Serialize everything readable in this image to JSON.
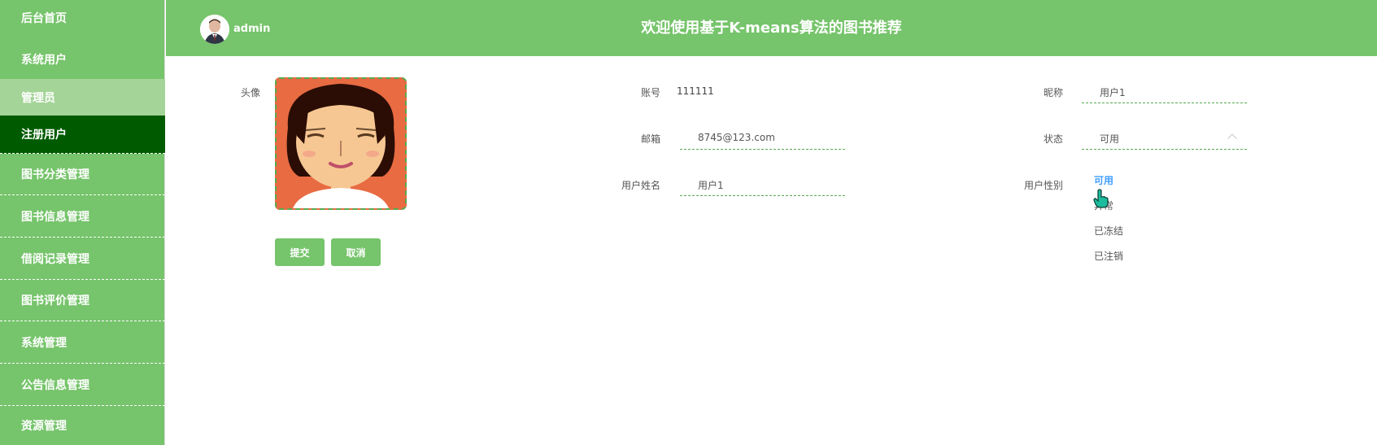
{
  "sidebar": {
    "items": [
      {
        "label": "后台首页"
      },
      {
        "label": "系统用户"
      },
      {
        "label": "管理员"
      },
      {
        "label": "注册用户"
      },
      {
        "label": "图书分类管理"
      },
      {
        "label": "图书信息管理"
      },
      {
        "label": "借阅记录管理"
      },
      {
        "label": "图书评价管理"
      },
      {
        "label": "系统管理"
      },
      {
        "label": "公告信息管理"
      },
      {
        "label": "资源管理"
      }
    ]
  },
  "header": {
    "username": "admin",
    "title": "欢迎使用基于K-means算法的图书推荐"
  },
  "form": {
    "avatar_label": "头像",
    "account_label": "账号",
    "account_value": "111111",
    "nickname_label": "昵称",
    "nickname_value": "用户1",
    "email_label": "邮箱",
    "email_value": "8745@123.com",
    "status_label": "状态",
    "status_value": "可用",
    "name_label": "用户姓名",
    "name_value": "用户1",
    "gender_label": "用户性别",
    "submit_label": "提交",
    "cancel_label": "取消"
  },
  "status_dropdown": {
    "options": [
      "可用",
      "异常",
      "已冻结",
      "已注销"
    ],
    "selected": "可用"
  },
  "colors": {
    "primary_green": "#76c46b",
    "active_dark_green": "#005b00",
    "highlight_blue": "#409eff"
  },
  "icons": {
    "avatar": "user-photo",
    "cursor": "hand-pointer-icon",
    "chevron": "chevron-up-icon"
  }
}
